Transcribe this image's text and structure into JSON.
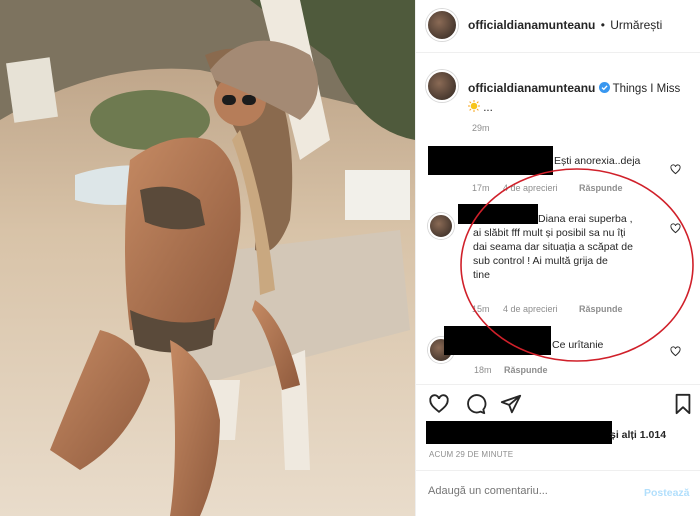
{
  "header": {
    "username": "officialdianamunteanu",
    "separator": "•",
    "follow_status": "Urmărești"
  },
  "caption": {
    "username": "officialdianamunteanu",
    "text": "Things I Miss",
    "time": "29m",
    "verified_icon": "verified-badge-icon",
    "emoji": "sun-emoji"
  },
  "comments": [
    {
      "text": "Ești anorexia..deja",
      "time": "17m",
      "likes": "4 de aprecieri",
      "reply": "Răspunde"
    },
    {
      "text": "Diana erai superba , ai slăbit fff mult și posibil sa nu îți dai seama dar situația a scăpat de sub control ! Ai multă grija de tine",
      "text_lines": [
        "Diana erai superba ,",
        "ai slăbit fff mult și posibil sa nu îți",
        "dai seama dar situația a scăpat de",
        "sub control ! Ai multă grija de",
        "tine"
      ],
      "time": "15m",
      "likes": "4 de aprecieri",
      "reply": "Răspunde"
    },
    {
      "text": "Ce urîtanie",
      "time": "18m",
      "reply": "Răspunde"
    }
  ],
  "likes_summary": {
    "text": "și alți 1.014"
  },
  "timestamp": "ACUM 29 DE MINUTE",
  "add_comment": {
    "placeholder": "Adaugă un comentariu...",
    "post_label": "Postează"
  },
  "colors": {
    "link_blue": "#b2dffc",
    "annotation_red": "#d0202a",
    "verified_blue": "#3897f0"
  }
}
